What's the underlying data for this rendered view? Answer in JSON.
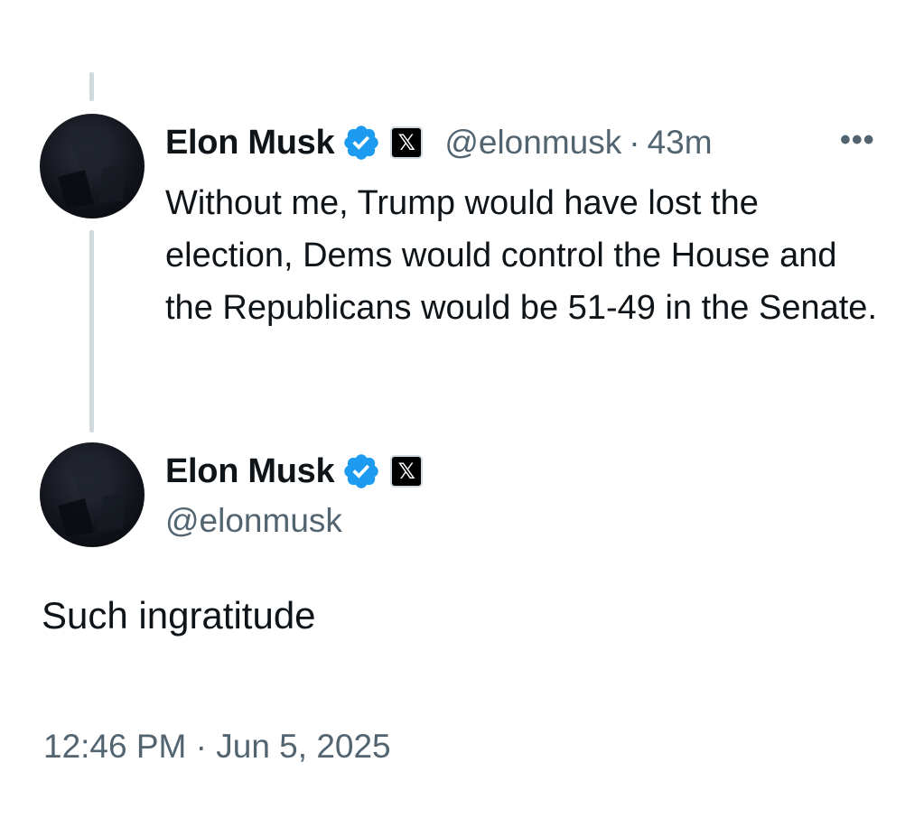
{
  "parent_tweet": {
    "display_name": "Elon Musk",
    "handle": "@elonmusk",
    "separator": "·",
    "time_ago": "43m",
    "more_label": "•••",
    "affiliate_badge": "𝕏",
    "icons": [
      "verified-badge-icon",
      "x-affiliate-icon",
      "more-options-icon"
    ],
    "text": "Without me, Trump would have lost the election, Dems would control the House and the Republicans would be 51-49 in the Senate."
  },
  "main_tweet": {
    "display_name": "Elon Musk",
    "handle": "@elonmusk",
    "affiliate_badge": "𝕏",
    "icons": [
      "verified-badge-icon",
      "x-affiliate-icon"
    ],
    "text": "Such ingratitude",
    "timestamp": "12:46 PM · Jun 5, 2025"
  },
  "colors": {
    "verified_blue": "#1d9bf0",
    "secondary_text": "#536471",
    "thread_line": "#cfd9de",
    "primary_text": "#0f1419"
  }
}
